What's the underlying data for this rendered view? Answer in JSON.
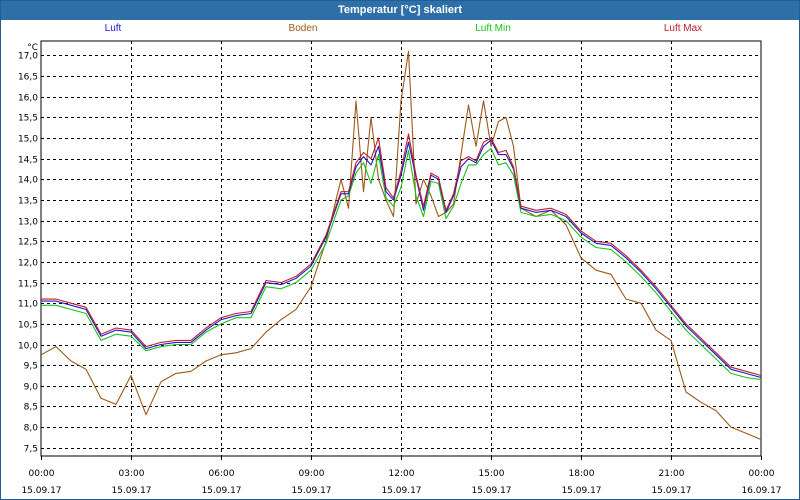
{
  "window": {
    "title": "Temperatur [°C] skaliert"
  },
  "chart_data": {
    "type": "line",
    "title": "Temperatur [°C] skaliert",
    "ylabel": "°C",
    "xlabel": "",
    "ylim": [
      7.3,
      17.35
    ],
    "xlim": [
      0,
      24
    ],
    "grid": true,
    "legend_placement": "top",
    "y_ticks": [
      "7,5",
      "8,0",
      "8,5",
      "9,0",
      "9,5",
      "10,0",
      "10,5",
      "11,0",
      "11,5",
      "12,0",
      "12,5",
      "13,0",
      "13,5",
      "14,0",
      "14,5",
      "15,0",
      "15,5",
      "16,0",
      "16,5",
      "17,0"
    ],
    "x_ticks": [
      {
        "time": "00:00",
        "date": "15.09.17"
      },
      {
        "time": "03:00",
        "date": "15.09.17"
      },
      {
        "time": "06:00",
        "date": "15.09.17"
      },
      {
        "time": "09:00",
        "date": "15.09.17"
      },
      {
        "time": "12:00",
        "date": "15.09.17"
      },
      {
        "time": "15:00",
        "date": "15.09.17"
      },
      {
        "time": "18:00",
        "date": "15.09.17"
      },
      {
        "time": "21:00",
        "date": "15.09.17"
      },
      {
        "time": "00:00",
        "date": "16.09.17"
      }
    ],
    "x": [
      0,
      0.5,
      1,
      1.5,
      2,
      2.5,
      3,
      3.5,
      4,
      4.5,
      5,
      5.5,
      6,
      6.5,
      7,
      7.5,
      8,
      8.5,
      9,
      9.5,
      10,
      10.25,
      10.5,
      10.75,
      11,
      11.25,
      11.5,
      11.75,
      12,
      12.25,
      12.5,
      12.75,
      13,
      13.25,
      13.5,
      13.75,
      14,
      14.25,
      14.5,
      14.75,
      15,
      15.25,
      15.5,
      15.75,
      16,
      16.5,
      17,
      17.5,
      18,
      18.5,
      19,
      19.5,
      20,
      20.5,
      21,
      21.5,
      22,
      22.5,
      23,
      23.5,
      24
    ],
    "series": [
      {
        "name": "Luft",
        "color": "#1a1ad0",
        "values": [
          11.05,
          11.05,
          10.95,
          10.85,
          10.2,
          10.35,
          10.3,
          9.9,
          10.0,
          10.05,
          10.05,
          10.35,
          10.6,
          10.7,
          10.75,
          11.5,
          11.45,
          11.6,
          11.9,
          12.6,
          13.65,
          13.65,
          14.3,
          14.55,
          14.35,
          14.8,
          13.7,
          13.5,
          14.1,
          14.9,
          14.05,
          13.25,
          14.1,
          14.0,
          13.2,
          13.6,
          14.3,
          14.5,
          14.4,
          14.8,
          14.95,
          14.6,
          14.6,
          14.25,
          13.3,
          13.2,
          13.25,
          13.1,
          12.7,
          12.45,
          12.4,
          12.1,
          11.75,
          11.35,
          10.9,
          10.45,
          10.1,
          9.75,
          9.4,
          9.3,
          9.2
        ]
      },
      {
        "name": "Boden",
        "color": "#9a5a1a",
        "values": [
          9.75,
          9.95,
          9.6,
          9.4,
          8.7,
          8.55,
          9.25,
          8.3,
          9.1,
          9.3,
          9.35,
          9.6,
          9.75,
          9.8,
          9.9,
          10.3,
          10.6,
          10.85,
          11.4,
          12.5,
          14.0,
          13.3,
          15.9,
          13.7,
          15.5,
          14.0,
          13.5,
          13.1,
          15.9,
          17.1,
          13.4,
          14.0,
          13.6,
          13.1,
          13.2,
          13.4,
          14.6,
          15.8,
          14.8,
          15.9,
          14.8,
          15.4,
          15.5,
          14.8,
          13.3,
          13.1,
          13.25,
          12.9,
          12.1,
          11.8,
          11.7,
          11.1,
          11.0,
          10.35,
          10.1,
          8.85,
          8.6,
          8.4,
          8.0,
          7.85,
          7.7
        ]
      },
      {
        "name": "Luft Min",
        "color": "#19c219",
        "values": [
          10.95,
          10.95,
          10.85,
          10.75,
          10.1,
          10.25,
          10.2,
          9.85,
          9.95,
          10.0,
          10.0,
          10.3,
          10.5,
          10.65,
          10.65,
          11.4,
          11.35,
          11.5,
          11.8,
          12.45,
          13.5,
          13.6,
          14.15,
          14.4,
          13.9,
          14.6,
          13.55,
          13.35,
          13.8,
          14.7,
          13.6,
          13.1,
          13.95,
          13.9,
          13.05,
          13.35,
          13.9,
          14.35,
          14.35,
          14.6,
          14.75,
          14.35,
          14.4,
          14.1,
          13.2,
          13.1,
          13.15,
          13.0,
          12.6,
          12.35,
          12.3,
          12.0,
          11.65,
          11.25,
          10.8,
          10.35,
          10.0,
          9.65,
          9.3,
          9.2,
          9.15
        ]
      },
      {
        "name": "Luft Max",
        "color": "#c01e2a",
        "values": [
          11.1,
          11.1,
          11.0,
          10.9,
          10.25,
          10.4,
          10.35,
          9.95,
          10.05,
          10.1,
          10.1,
          10.4,
          10.65,
          10.75,
          10.8,
          11.55,
          11.5,
          11.65,
          11.95,
          12.65,
          13.7,
          13.7,
          14.4,
          14.65,
          14.5,
          15.0,
          13.8,
          13.55,
          14.2,
          15.1,
          14.1,
          13.35,
          14.15,
          14.05,
          13.25,
          13.65,
          14.45,
          14.55,
          14.45,
          14.9,
          15.0,
          14.65,
          14.7,
          14.3,
          13.35,
          13.25,
          13.3,
          13.15,
          12.75,
          12.5,
          12.45,
          12.15,
          11.8,
          11.4,
          10.95,
          10.5,
          10.15,
          9.8,
          9.45,
          9.35,
          9.25
        ]
      }
    ]
  }
}
